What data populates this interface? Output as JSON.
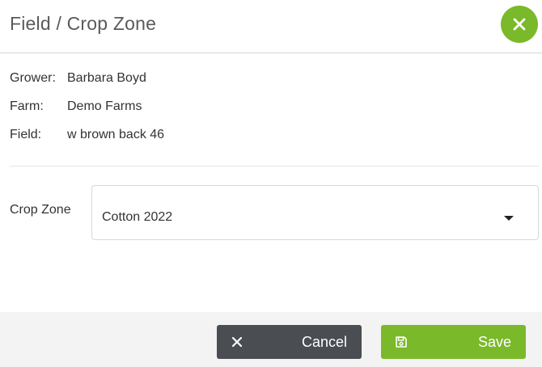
{
  "dialog": {
    "title": "Field / Crop Zone",
    "close_icon": "close-icon",
    "accent_color": "#7ab929"
  },
  "info": {
    "grower_label": "Grower:",
    "grower_value": "Barbara Boyd",
    "farm_label": "Farm:",
    "farm_value": "Demo Farms",
    "field_label": "Field:",
    "field_value": "w brown back 46"
  },
  "crop_zone": {
    "label": "Crop Zone",
    "selected_value": "Cotton 2022",
    "dropdown_icon": "caret-down-icon"
  },
  "footer": {
    "cancel_label": "Cancel",
    "cancel_icon": "close-icon",
    "cancel_color": "#4a4d52",
    "save_label": "Save",
    "save_icon": "save-icon",
    "save_color": "#7ab929"
  }
}
